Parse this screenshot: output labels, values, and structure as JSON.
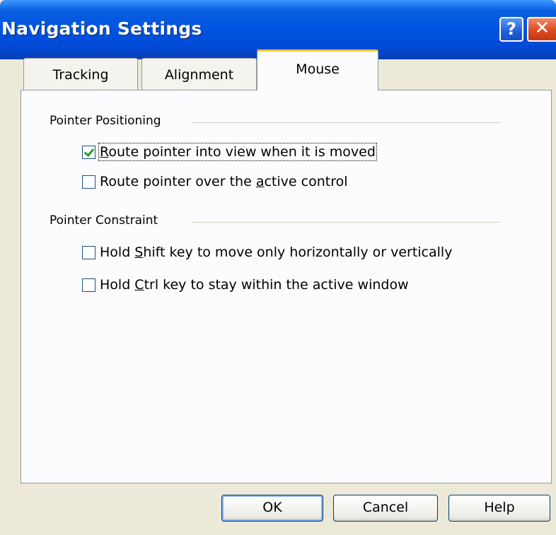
{
  "window": {
    "title": "Navigation Settings",
    "help_glyph": "?",
    "close_glyph": "✕"
  },
  "tabs": [
    {
      "label": "Tracking",
      "active": false
    },
    {
      "label": "Alignment",
      "active": false
    },
    {
      "label": "Mouse",
      "active": true
    }
  ],
  "groups": [
    {
      "label": "Pointer Positioning",
      "options": [
        {
          "pre": "",
          "accel": "R",
          "post": "oute pointer into view when it is moved",
          "checked": true
        },
        {
          "pre": "Route pointer over the ",
          "accel": "a",
          "post": "ctive control",
          "checked": false
        }
      ]
    },
    {
      "label": "Pointer Constraint",
      "options": [
        {
          "pre": "Hold ",
          "accel": "S",
          "post": "hift key to move only horizontally or vertically",
          "checked": false
        },
        {
          "pre": "Hold ",
          "accel": "C",
          "post": "trl key to stay within the active window",
          "checked": false
        }
      ]
    }
  ],
  "buttons": {
    "ok": "OK",
    "cancel": "Cancel",
    "help": "Help"
  },
  "colors": {
    "titlebar": "#0053E1",
    "active_tab_accent": "#FFC83C",
    "checkmark": "#21A121"
  }
}
